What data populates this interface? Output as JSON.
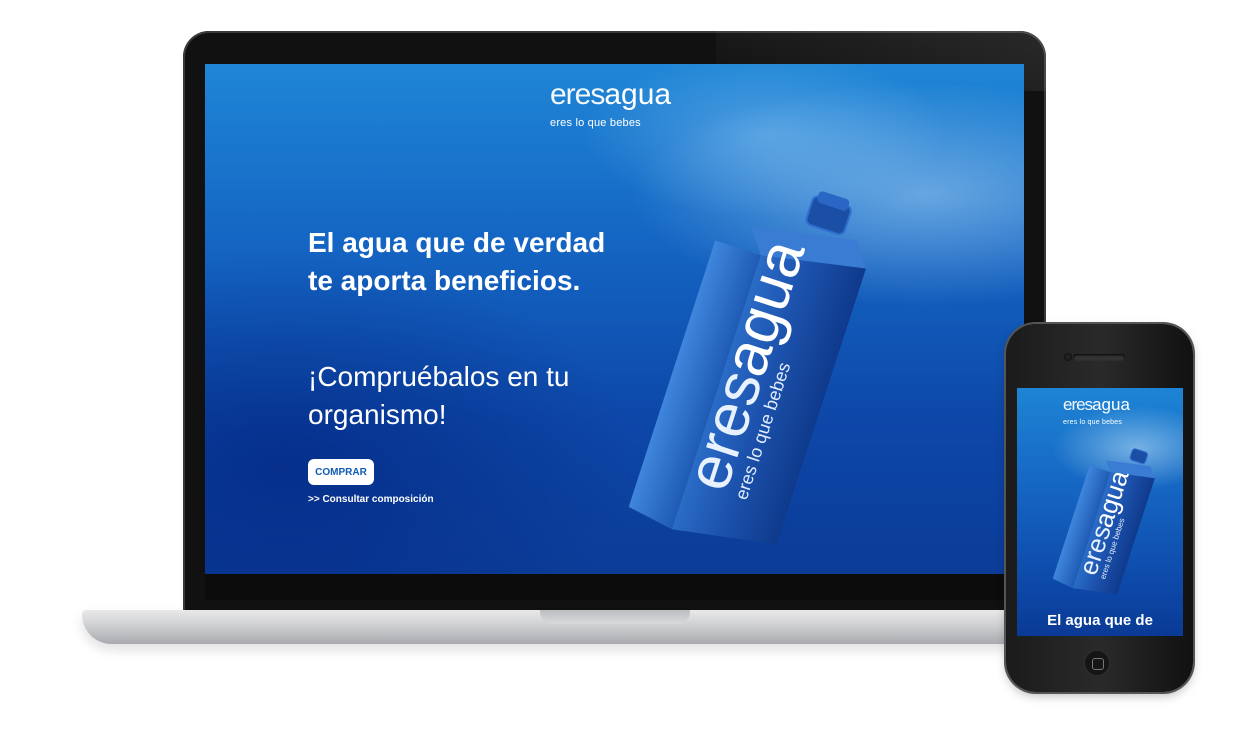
{
  "laptop_page": {
    "logo": {
      "word1": "eres",
      "word2": "agua",
      "tagline": "eres lo que bebes"
    },
    "hero_title": "El agua que de verdad te aporta beneficios.",
    "hero_subtitle": "¡Compruébalos en tu organismo!",
    "buy_button": "COMPRAR",
    "composition_link": ">> Consultar composición",
    "bottle": {
      "brand1": "eres",
      "brand2": "agua",
      "tagline": "eres lo que bebes"
    }
  },
  "phone_page": {
    "logo": {
      "word1": "eres",
      "word2": "agua",
      "tagline": "eres lo que bebes"
    },
    "hero_title_visible": "El agua que de",
    "bottle": {
      "brand1": "eres",
      "brand2": "agua",
      "tagline": "eres lo que bebes"
    }
  },
  "colors": {
    "screen_blue_top": "#1f86d6",
    "screen_blue_bottom": "#0b3c98",
    "button_text": "#0f5bb5",
    "bottle_blue": "#1a4fa8"
  }
}
